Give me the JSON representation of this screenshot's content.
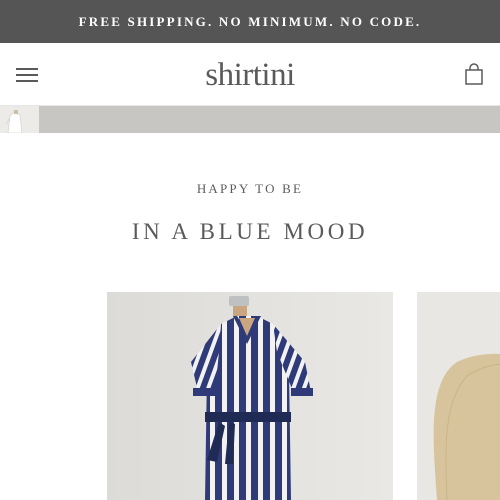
{
  "announcement": {
    "text": "FREE SHIPPING. NO MINIMUM. NO CODE."
  },
  "header": {
    "logo": "shirtini",
    "menu_icon": "hamburger-menu-icon",
    "cart_icon": "shopping-bag-icon"
  },
  "collection": {
    "subtitle": "HAPPY TO BE",
    "title": "IN A BLUE MOOD"
  },
  "products": [
    {
      "image": "navy-white-striped-shirt-dress-on-dress-form"
    },
    {
      "image": "burlap-dress-form"
    }
  ],
  "colors": {
    "announcement_bg": "#555555",
    "text": "#5c5c5c",
    "strip": "#c7c6c3",
    "stripe_navy": "#2f3a78"
  }
}
